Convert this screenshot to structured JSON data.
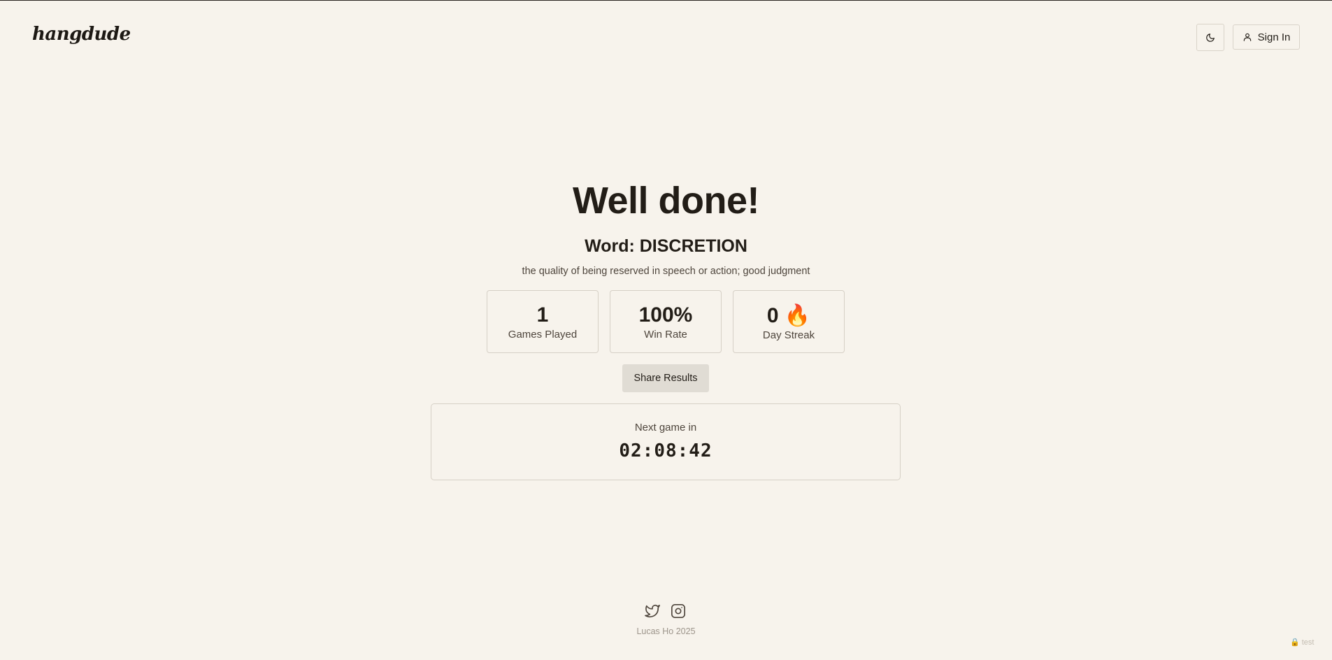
{
  "header": {
    "logo": "hangdude",
    "theme_toggle_icon": "moon-icon",
    "sign_in_label": "Sign In",
    "sign_in_icon": "user-icon"
  },
  "result": {
    "title": "Well done!",
    "word": "Word: DISCRETION",
    "definition": "the quality of being reserved in speech or action; good judgment"
  },
  "stats": [
    {
      "value": "1",
      "label": "Games Played"
    },
    {
      "value": "100%",
      "label": "Win Rate"
    },
    {
      "value": "0 🔥",
      "label": "Day Streak"
    }
  ],
  "share_label": "Share Results",
  "next_game": {
    "label": "Next game in",
    "countdown": "02:08:42"
  },
  "footer": {
    "social_icons": [
      "twitter-icon",
      "instagram-icon"
    ],
    "credit": "Lucas Ho 2025",
    "env_badge": "🔒 test"
  },
  "colors": {
    "background": "#f7f3ec",
    "text": "#221d17",
    "muted_text": "#4e453c",
    "border": "#d6d0c6",
    "button_fill": "#e0dcd4"
  }
}
